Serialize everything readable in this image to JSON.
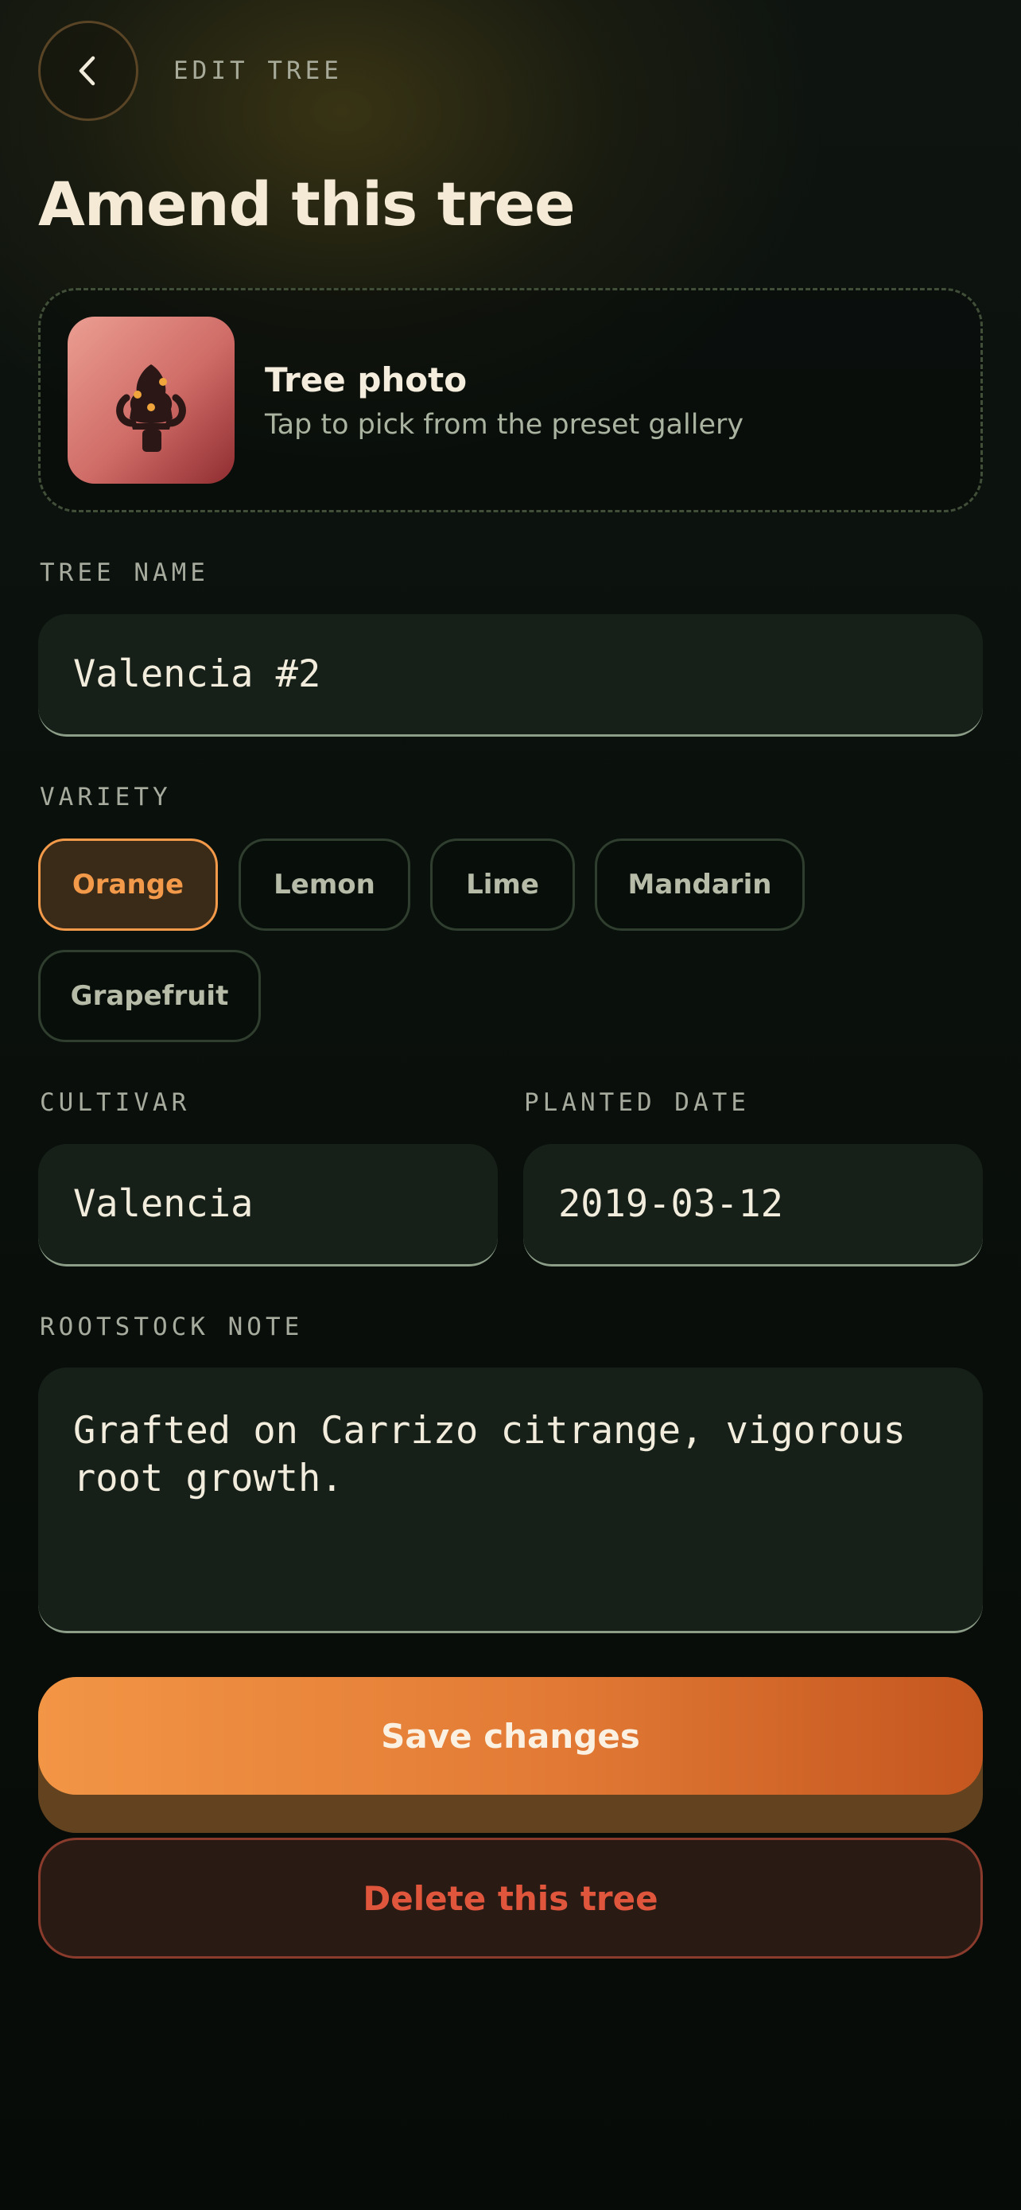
{
  "header": {
    "back_icon": "chevron-left-icon",
    "label": "EDIT TREE"
  },
  "page_title": "Amend this tree",
  "photo": {
    "icon": "citrus-tree-icon",
    "title": "Tree photo",
    "hint": "Tap to pick from the preset gallery"
  },
  "tree_name": {
    "label": "TREE NAME",
    "value": "Valencia #2"
  },
  "variety": {
    "label": "VARIETY",
    "options": [
      "Orange",
      "Lemon",
      "Lime",
      "Mandarin",
      "Grapefruit"
    ],
    "selected": "Orange"
  },
  "cultivar": {
    "label": "CULTIVAR",
    "value": "Valencia"
  },
  "planted_date": {
    "label": "PLANTED DATE",
    "value": "2019-03-12"
  },
  "rootstock": {
    "label": "ROOTSTOCK NOTE",
    "value": "Grafted on Carrizo citrange, vigorous root growth."
  },
  "actions": {
    "save_label": "Save changes",
    "delete_label": "Delete this tree"
  },
  "colors": {
    "accent": "#f39a4a",
    "danger": "#e0563c",
    "background": "#0a100c"
  }
}
